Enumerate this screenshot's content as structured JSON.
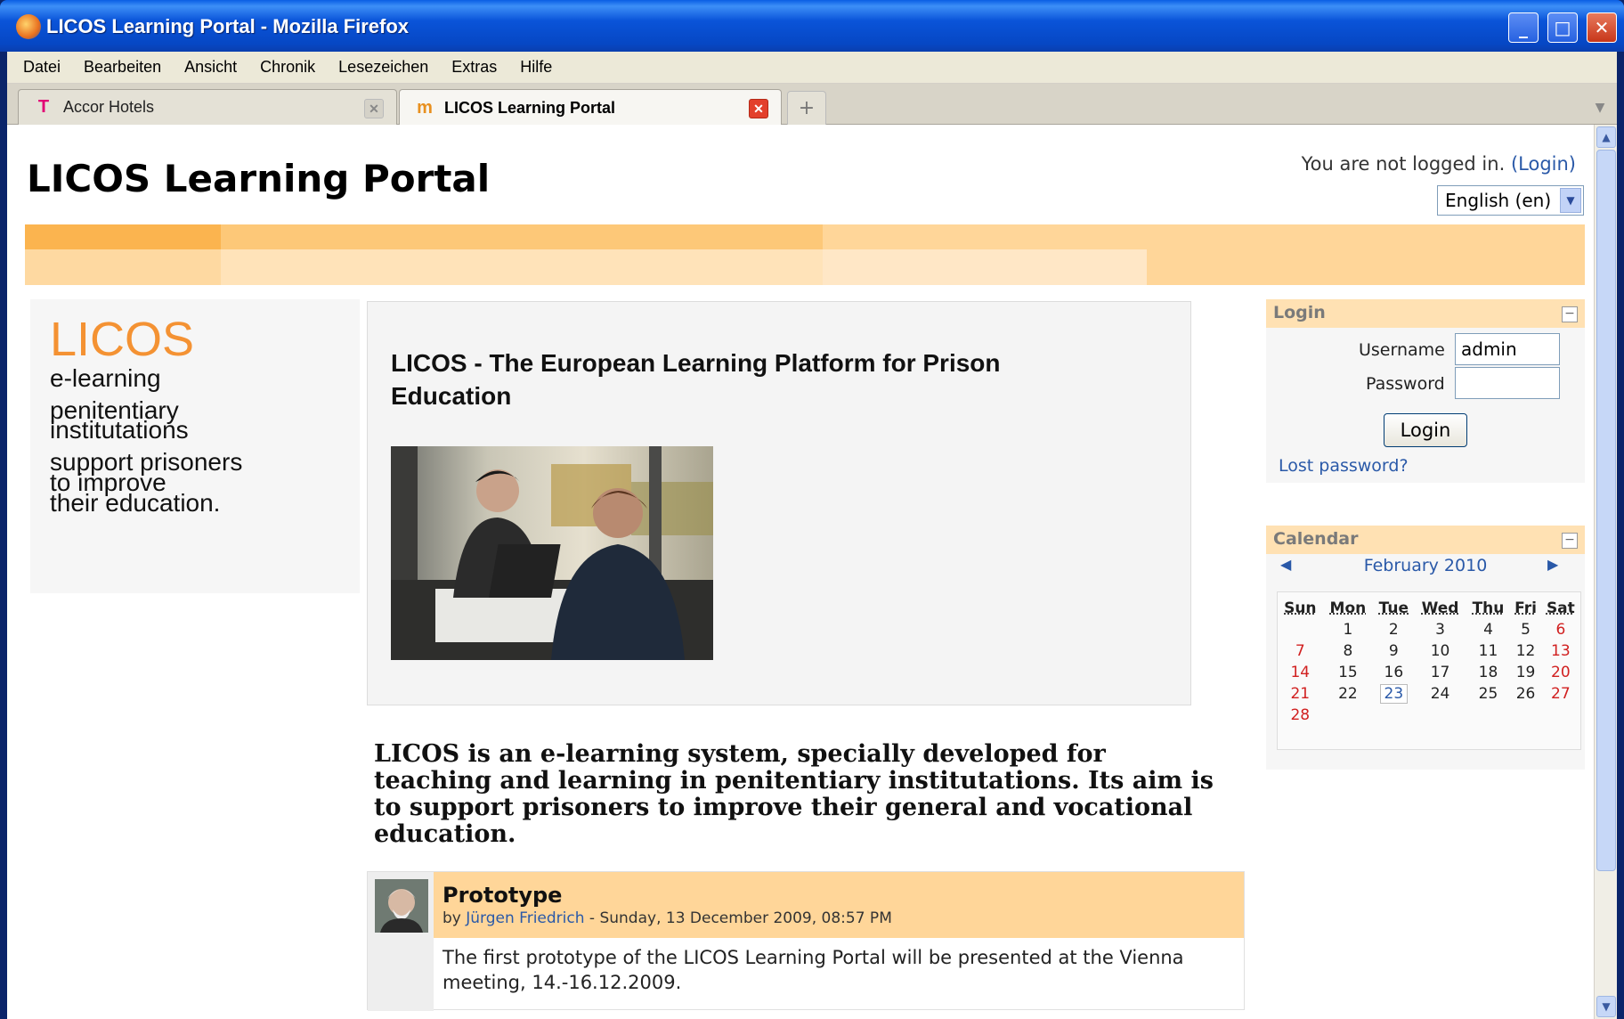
{
  "window": {
    "title": "LICOS Learning Portal - Mozilla Firefox"
  },
  "menu": [
    "Datei",
    "Bearbeiten",
    "Ansicht",
    "Chronik",
    "Lesezeichen",
    "Extras",
    "Hilfe"
  ],
  "tabs": [
    {
      "label": "Accor Hotels",
      "icon": "telekom-t-icon"
    },
    {
      "label": "LICOS Learning Portal",
      "icon": "moodle-m-icon"
    }
  ],
  "header": {
    "title": "LICOS Learning Portal",
    "login_status": "You are not logged in.",
    "login_link": "(Login)",
    "language": "English (en)"
  },
  "left_block": {
    "logo": "LICOS",
    "line1": "e-learning",
    "line2a": "penitentiary",
    "line2b": "institutations",
    "line3a": "support prisoners",
    "line3b": "to improve",
    "line3c": "their education."
  },
  "intro": {
    "title": "LICOS - The European Learning Platform for Prison Education"
  },
  "mission": "LICOS is an e-learning system, specially developed for teaching and learning in penitentiary institutations. Its aim is to support prisoners to improve their general and vocational education.",
  "post": {
    "subject": "Prototype",
    "by": "by",
    "author": "Jürgen Friedrich",
    "date": "- Sunday, 13 December 2009, 08:57 PM",
    "body": "The first prototype of the LICOS Learning Portal will be presented at the Vienna meeting, 14.-16.12.2009."
  },
  "login_block": {
    "title": "Login",
    "username_label": "Username",
    "username_value": "admin",
    "password_label": "Password",
    "password_value": "",
    "button": "Login",
    "lost_password": "Lost password?"
  },
  "calendar": {
    "title": "Calendar",
    "month": "February 2010",
    "days": [
      "Sun",
      "Mon",
      "Tue",
      "Wed",
      "Thu",
      "Fri",
      "Sat"
    ],
    "weeks": [
      [
        "",
        "1",
        "2",
        "3",
        "4",
        "5",
        "6"
      ],
      [
        "7",
        "8",
        "9",
        "10",
        "11",
        "12",
        "13"
      ],
      [
        "14",
        "15",
        "16",
        "17",
        "18",
        "19",
        "20"
      ],
      [
        "21",
        "22",
        "23",
        "24",
        "25",
        "26",
        "27"
      ],
      [
        "28",
        "",
        "",
        "",
        "",
        "",
        ""
      ]
    ],
    "today": "23"
  }
}
